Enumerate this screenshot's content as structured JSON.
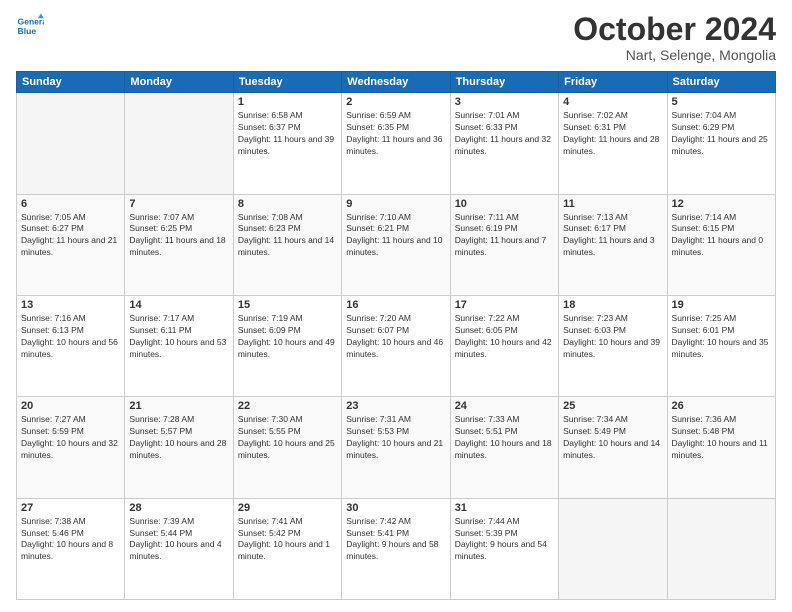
{
  "header": {
    "logo_line1": "General",
    "logo_line2": "Blue",
    "month": "October 2024",
    "location": "Nart, Selenge, Mongolia"
  },
  "weekdays": [
    "Sunday",
    "Monday",
    "Tuesday",
    "Wednesday",
    "Thursday",
    "Friday",
    "Saturday"
  ],
  "weeks": [
    [
      {
        "day": "",
        "info": ""
      },
      {
        "day": "",
        "info": ""
      },
      {
        "day": "1",
        "info": "Sunrise: 6:58 AM\nSunset: 6:37 PM\nDaylight: 11 hours and 39 minutes."
      },
      {
        "day": "2",
        "info": "Sunrise: 6:59 AM\nSunset: 6:35 PM\nDaylight: 11 hours and 36 minutes."
      },
      {
        "day": "3",
        "info": "Sunrise: 7:01 AM\nSunset: 6:33 PM\nDaylight: 11 hours and 32 minutes."
      },
      {
        "day": "4",
        "info": "Sunrise: 7:02 AM\nSunset: 6:31 PM\nDaylight: 11 hours and 28 minutes."
      },
      {
        "day": "5",
        "info": "Sunrise: 7:04 AM\nSunset: 6:29 PM\nDaylight: 11 hours and 25 minutes."
      }
    ],
    [
      {
        "day": "6",
        "info": "Sunrise: 7:05 AM\nSunset: 6:27 PM\nDaylight: 11 hours and 21 minutes."
      },
      {
        "day": "7",
        "info": "Sunrise: 7:07 AM\nSunset: 6:25 PM\nDaylight: 11 hours and 18 minutes."
      },
      {
        "day": "8",
        "info": "Sunrise: 7:08 AM\nSunset: 6:23 PM\nDaylight: 11 hours and 14 minutes."
      },
      {
        "day": "9",
        "info": "Sunrise: 7:10 AM\nSunset: 6:21 PM\nDaylight: 11 hours and 10 minutes."
      },
      {
        "day": "10",
        "info": "Sunrise: 7:11 AM\nSunset: 6:19 PM\nDaylight: 11 hours and 7 minutes."
      },
      {
        "day": "11",
        "info": "Sunrise: 7:13 AM\nSunset: 6:17 PM\nDaylight: 11 hours and 3 minutes."
      },
      {
        "day": "12",
        "info": "Sunrise: 7:14 AM\nSunset: 6:15 PM\nDaylight: 11 hours and 0 minutes."
      }
    ],
    [
      {
        "day": "13",
        "info": "Sunrise: 7:16 AM\nSunset: 6:13 PM\nDaylight: 10 hours and 56 minutes."
      },
      {
        "day": "14",
        "info": "Sunrise: 7:17 AM\nSunset: 6:11 PM\nDaylight: 10 hours and 53 minutes."
      },
      {
        "day": "15",
        "info": "Sunrise: 7:19 AM\nSunset: 6:09 PM\nDaylight: 10 hours and 49 minutes."
      },
      {
        "day": "16",
        "info": "Sunrise: 7:20 AM\nSunset: 6:07 PM\nDaylight: 10 hours and 46 minutes."
      },
      {
        "day": "17",
        "info": "Sunrise: 7:22 AM\nSunset: 6:05 PM\nDaylight: 10 hours and 42 minutes."
      },
      {
        "day": "18",
        "info": "Sunrise: 7:23 AM\nSunset: 6:03 PM\nDaylight: 10 hours and 39 minutes."
      },
      {
        "day": "19",
        "info": "Sunrise: 7:25 AM\nSunset: 6:01 PM\nDaylight: 10 hours and 35 minutes."
      }
    ],
    [
      {
        "day": "20",
        "info": "Sunrise: 7:27 AM\nSunset: 5:59 PM\nDaylight: 10 hours and 32 minutes."
      },
      {
        "day": "21",
        "info": "Sunrise: 7:28 AM\nSunset: 5:57 PM\nDaylight: 10 hours and 28 minutes."
      },
      {
        "day": "22",
        "info": "Sunrise: 7:30 AM\nSunset: 5:55 PM\nDaylight: 10 hours and 25 minutes."
      },
      {
        "day": "23",
        "info": "Sunrise: 7:31 AM\nSunset: 5:53 PM\nDaylight: 10 hours and 21 minutes."
      },
      {
        "day": "24",
        "info": "Sunrise: 7:33 AM\nSunset: 5:51 PM\nDaylight: 10 hours and 18 minutes."
      },
      {
        "day": "25",
        "info": "Sunrise: 7:34 AM\nSunset: 5:49 PM\nDaylight: 10 hours and 14 minutes."
      },
      {
        "day": "26",
        "info": "Sunrise: 7:36 AM\nSunset: 5:48 PM\nDaylight: 10 hours and 11 minutes."
      }
    ],
    [
      {
        "day": "27",
        "info": "Sunrise: 7:38 AM\nSunset: 5:46 PM\nDaylight: 10 hours and 8 minutes."
      },
      {
        "day": "28",
        "info": "Sunrise: 7:39 AM\nSunset: 5:44 PM\nDaylight: 10 hours and 4 minutes."
      },
      {
        "day": "29",
        "info": "Sunrise: 7:41 AM\nSunset: 5:42 PM\nDaylight: 10 hours and 1 minute."
      },
      {
        "day": "30",
        "info": "Sunrise: 7:42 AM\nSunset: 5:41 PM\nDaylight: 9 hours and 58 minutes."
      },
      {
        "day": "31",
        "info": "Sunrise: 7:44 AM\nSunset: 5:39 PM\nDaylight: 9 hours and 54 minutes."
      },
      {
        "day": "",
        "info": ""
      },
      {
        "day": "",
        "info": ""
      }
    ]
  ]
}
